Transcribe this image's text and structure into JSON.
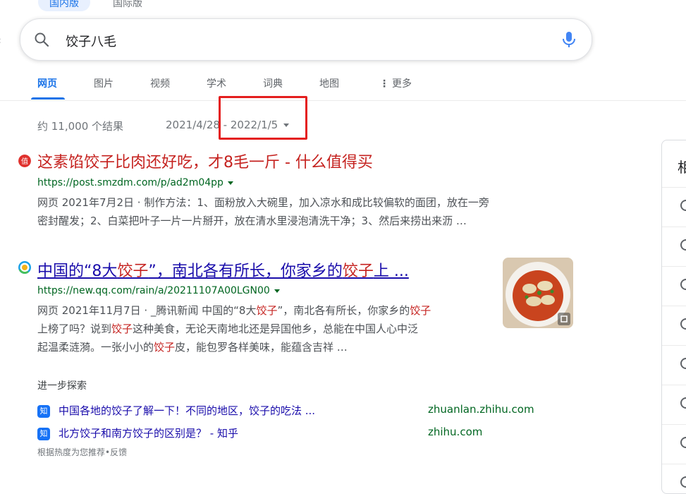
{
  "region_tabs": {
    "domestic": "国内版",
    "international": "国际版"
  },
  "search": {
    "query": "饺子八毛"
  },
  "tabs": [
    "网页",
    "图片",
    "视频",
    "学术",
    "词典",
    "地图",
    "更多"
  ],
  "stats": {
    "count": "约 11,000 个结果",
    "date_range": "2021/4/28 - 2022/1/5"
  },
  "results": [
    {
      "title": "这素馅饺子比肉还好吃，才8毛一斤 - 什么值得买",
      "url": "https://post.smzdm.com/p/ad2m04pp",
      "line1": "网页 2021年7月2日 · 制作方法：1、面粉放入大碗里，加入凉水和成比较偏软的面团，放在一旁",
      "line2": "密封醒发；2、白菜把叶子一片一片掰开，放在清水里浸泡清洗干净；3、然后来捞出来沥 …"
    },
    {
      "title_a": "中国的“8大",
      "title_hl1": "饺子",
      "title_b": "”，南北各有所长，你家乡的",
      "title_hl2": "饺子",
      "title_c": "上 ...",
      "url": "https://new.qq.com/rain/a/20211107A00LGN00",
      "l1_a": "网页 2021年11月7日 · _腾讯新闻 中国的“8大",
      "l1_hl": "饺子",
      "l1_b": "”，南北各有所长，你家乡的",
      "l1_hl2": "饺子",
      "l2_a": "上榜了吗？说到",
      "l2_hl": "饺子",
      "l2_b": "这种美食，无论天南地北还是异国他乡，总能在中国人心中泛",
      "l3_a": "起温柔涟漪。一张小小的",
      "l3_hl": "饺子",
      "l3_b": "皮，能包罗各样美味，能蕴含吉祥 …"
    }
  ],
  "more_explore": {
    "label": "进一步探索",
    "items": [
      {
        "text": "中国各地的饺子了解一下！不同的地区，饺子的吃法 ...",
        "site": "zhuanlan.zhihu.com"
      },
      {
        "text": "北方饺子和南方饺子的区别是？ - 知乎",
        "site": "zhihu.com"
      }
    ],
    "zhihu_badge": "知",
    "footnote": "根据热度为您推荐•反馈"
  },
  "right_panel": {
    "title_partial": "相"
  },
  "colors": {
    "link": "#1a0dab",
    "url": "#006621",
    "highlight": "#c5221f",
    "accent": "#1a73e8",
    "annotation": "#e41e1e"
  }
}
